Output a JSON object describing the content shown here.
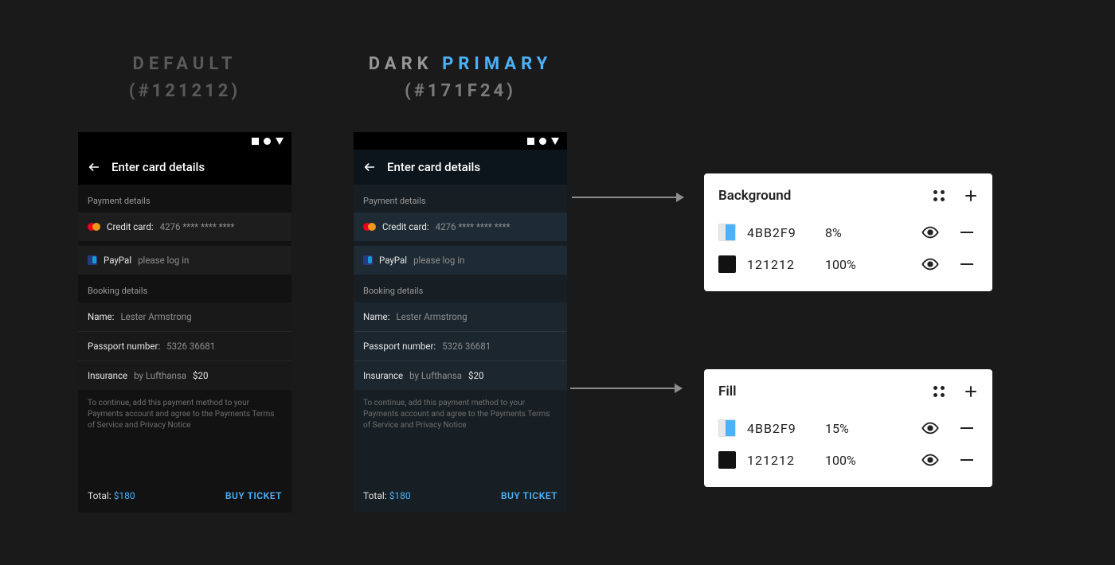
{
  "headings": {
    "default": {
      "line1": "DEFAULT",
      "line2": "(#121212)"
    },
    "dark": {
      "line1a": "DARK ",
      "line1b": "PRIMARY",
      "line2": "(#171F24)"
    }
  },
  "phone": {
    "appbar_title": "Enter card details",
    "payment_section_label": "Payment details",
    "credit_card_label": "Credit card:",
    "credit_card_value": "4276 **** **** ****",
    "paypal_label": "PayPal",
    "paypal_hint": "please log in",
    "booking_section_label": "Booking details",
    "name_label": "Name:",
    "name_value": "Lester Armstrong",
    "passport_label": "Passport number:",
    "passport_value": "5326 36681",
    "insurance_label": "Insurance",
    "insurance_by": "by Lufthansa",
    "insurance_price": "$20",
    "terms": "To continue, add this payment method to your Payments account and agree to the Payments Terms of Service and Privacy Notice",
    "total_label": "Total:",
    "total_value": "$180",
    "buy_label": "BUY TICKET"
  },
  "panels": {
    "background": {
      "title": "Background",
      "rows": [
        {
          "swatch": "sw-blue",
          "hex": "4BB2F9",
          "opacity": "8%"
        },
        {
          "swatch": "sw-black",
          "hex": "121212",
          "opacity": "100%"
        }
      ]
    },
    "fill": {
      "title": "Fill",
      "rows": [
        {
          "swatch": "sw-blue",
          "hex": "4BB2F9",
          "opacity": "15%"
        },
        {
          "swatch": "sw-black",
          "hex": "121212",
          "opacity": "100%"
        }
      ]
    }
  },
  "colors": {
    "accent": "#4BB2F9",
    "bg_default": "#121212",
    "bg_dark": "#171F24"
  }
}
